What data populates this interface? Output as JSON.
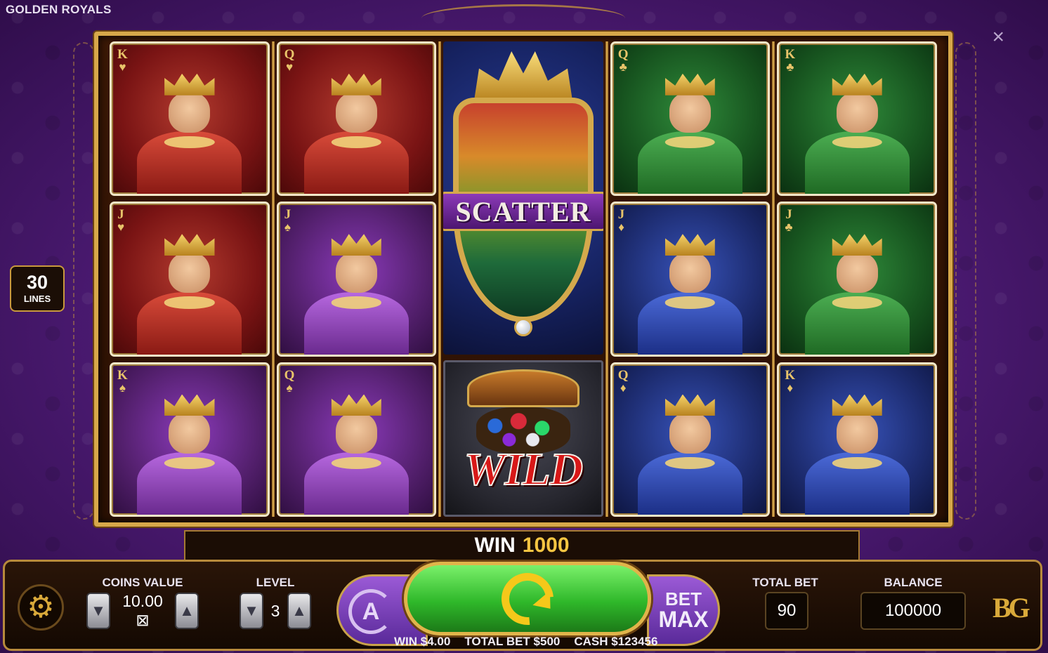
{
  "app": {
    "title": "GOLDEN ROYALS",
    "close_label": "×"
  },
  "lines": {
    "count": "30",
    "label": "LINES"
  },
  "reels": [
    [
      {
        "rank": "K",
        "suit": "♥",
        "theme": "red",
        "character": "king-of-hearts"
      },
      {
        "rank": "J",
        "suit": "♥",
        "theme": "red",
        "character": "jack-of-hearts"
      },
      {
        "rank": "K",
        "suit": "♠",
        "theme": "purple",
        "character": "king-of-spades"
      }
    ],
    [
      {
        "rank": "Q",
        "suit": "♥",
        "theme": "red",
        "character": "queen-of-hearts"
      },
      {
        "rank": "J",
        "suit": "♠",
        "theme": "purple",
        "character": "jack-of-spades"
      },
      {
        "rank": "Q",
        "suit": "♠",
        "theme": "purple",
        "character": "queen-of-spades"
      }
    ],
    [
      {
        "type": "scatter",
        "label": "SCATTER"
      },
      {
        "type": "wild",
        "label": "WILD"
      }
    ],
    [
      {
        "rank": "Q",
        "suit": "♣",
        "theme": "green",
        "character": "queen-of-clubs"
      },
      {
        "rank": "J",
        "suit": "♦",
        "theme": "blue",
        "character": "jack-of-diamonds"
      },
      {
        "rank": "Q",
        "suit": "♦",
        "theme": "blue",
        "character": "queen-of-diamonds"
      }
    ],
    [
      {
        "rank": "K",
        "suit": "♣",
        "theme": "green",
        "character": "king-of-clubs"
      },
      {
        "rank": "J",
        "suit": "♣",
        "theme": "green",
        "character": "jack-of-clubs"
      },
      {
        "rank": "K",
        "suit": "♦",
        "theme": "blue",
        "character": "king-of-diamonds"
      }
    ]
  ],
  "win_bar": {
    "label": "WIN",
    "value": "1000"
  },
  "controls": {
    "coins_value_label": "COINS VALUE",
    "coins_value": "10.00 ⊠",
    "level_label": "LEVEL",
    "level": "3",
    "auto_label": "A",
    "bet_max_line1": "BET",
    "bet_max_line2": "MAX",
    "total_bet_label": "TOTAL BET",
    "total_bet": "90",
    "balance_label": "BALANCE",
    "balance": "100000",
    "brand_logo": "BG",
    "down_arrow": "▼",
    "up_arrow": "▲",
    "gear_glyph": "⚙"
  },
  "status": {
    "win": "WIN $4.00",
    "total_bet": "TOTAL BET $500",
    "cash": "CASH $123456"
  },
  "colors": {
    "background": "#4b1a72",
    "frame_gold": "#d7a84a",
    "spin_green": "#2fb82a",
    "win_value": "#f5c542",
    "panel_dark": "#140902"
  }
}
